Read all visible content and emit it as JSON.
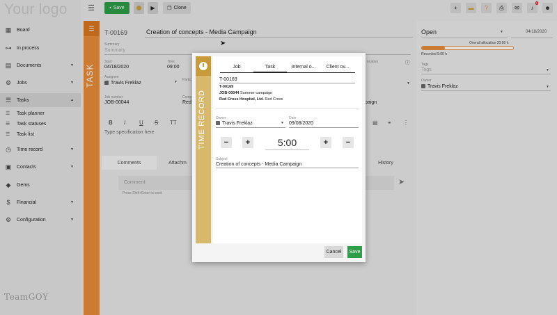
{
  "sidebar": {
    "logo": "Your logo",
    "items": [
      {
        "label": "Board",
        "icon": "grid-icon"
      },
      {
        "label": "In process",
        "icon": "flow-icon"
      },
      {
        "label": "Documents",
        "icon": "document-icon"
      },
      {
        "label": "Jobs",
        "icon": "cogs-icon"
      },
      {
        "label": "Tasks",
        "icon": "tasks-icon"
      },
      {
        "label": "Time record",
        "icon": "clock-icon"
      },
      {
        "label": "Contacts",
        "icon": "contact-card-icon"
      },
      {
        "label": "Gems",
        "icon": "gem-icon"
      },
      {
        "label": "Financial",
        "icon": "dollar-icon"
      },
      {
        "label": "Configuration",
        "icon": "gear-icon"
      }
    ],
    "sub_items": [
      "Task planner",
      "Task statuses",
      "Task list"
    ],
    "footer_logo": "TeamGOY"
  },
  "toolbar": {
    "save_label": "Save",
    "clone_label": "Clone",
    "notification_count": "1"
  },
  "task": {
    "strip_label": "TASK",
    "id": "T-00169",
    "title": "Creation of concepts - Media Campaign",
    "summary_label": "Summary",
    "summary_placeholder": "Summary",
    "start_label": "Start",
    "start_value": "04/18/2020",
    "time_label": "Time",
    "time_value": "09:00",
    "assignee_label": "Assignee",
    "assignee_value": "Travis Freklaz",
    "participants_label": "Partic",
    "job_number_label": "Job number",
    "job_number_value": "JOB-00044",
    "company_label": "Comp",
    "company_value": "Red",
    "location_label": "ocation",
    "campaign_fragment": "paign",
    "spec_placeholder": "Type specification here",
    "tabs": [
      "Comments",
      "Attachm",
      "History"
    ],
    "comment_placeholder": "Comment",
    "comment_hint": "Press Shift+Enter to send"
  },
  "right": {
    "status": "Open",
    "date": "04/18/2020",
    "allocation_label": "Overall allocation 20:00 h",
    "recorded_label": "Recorded 5:00 h",
    "allocation_fraction": 0.25,
    "tags_label": "Tags",
    "tags_placeholder": "Tags",
    "owner_label": "Owner",
    "owner_value": "Travis Freklaz"
  },
  "modal": {
    "strip_label": "TIME RECORD",
    "tabs": [
      "Job",
      "Task",
      "Internal o...",
      "Client ov..."
    ],
    "task_id": "T-00169",
    "task_id_small": "T-00169",
    "job_code": "JOB-00044",
    "job_name": "Summer campaign",
    "client_bold": "Red Cross Hospital, Ltd.",
    "client_name": "Red Cross",
    "owner_label": "Owner",
    "owner_value": "Travis Freklaz",
    "date_label": "Date",
    "date_value": "09/08/2020",
    "duration": "5:00",
    "subject_label": "Subject",
    "subject_value": "Creation of concepts - Media Campaign",
    "cancel_label": "Cancel",
    "save_label": "Save"
  }
}
